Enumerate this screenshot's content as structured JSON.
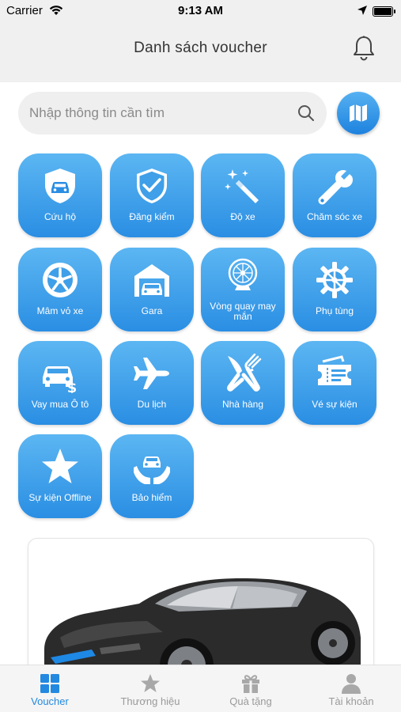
{
  "status_bar": {
    "carrier": "Carrier",
    "time": "9:13 AM"
  },
  "header": {
    "title": "Danh sách voucher"
  },
  "search": {
    "placeholder": "Nhập thông tin cần tìm",
    "value": ""
  },
  "categories": [
    {
      "label": "Cứu hộ",
      "icon": "shield-car-icon"
    },
    {
      "label": "Đăng kiểm",
      "icon": "shield-check-icon"
    },
    {
      "label": "Độ xe",
      "icon": "magic-wand-icon"
    },
    {
      "label": "Chăm sóc xe",
      "icon": "wrench-icon"
    },
    {
      "label": "Mâm vỏ xe",
      "icon": "wheel-icon"
    },
    {
      "label": "Gara",
      "icon": "garage-icon"
    },
    {
      "label": "Vòng quay may mắn",
      "icon": "lucky-wheel-icon"
    },
    {
      "label": "Phụ tùng",
      "icon": "gear-icon"
    },
    {
      "label": "Vay mua Ô tô",
      "icon": "car-loan-icon"
    },
    {
      "label": "Du lịch",
      "icon": "airplane-icon"
    },
    {
      "label": "Nhà hàng",
      "icon": "restaurant-icon"
    },
    {
      "label": "Vé sự kiện",
      "icon": "ticket-icon"
    },
    {
      "label": "Sự kiện Offline",
      "icon": "star-icon"
    },
    {
      "label": "Bảo hiểm",
      "icon": "insurance-icon"
    }
  ],
  "tabs": [
    {
      "label": "Voucher",
      "icon": "grid-icon",
      "active": true
    },
    {
      "label": "Thương hiệu",
      "icon": "star-icon",
      "active": false
    },
    {
      "label": "Quà tặng",
      "icon": "gift-icon",
      "active": false
    },
    {
      "label": "Tài khoản",
      "icon": "person-icon",
      "active": false
    }
  ],
  "colors": {
    "accent": "#2389e0",
    "tile_top": "#5cb6f2",
    "tile_bottom": "#2a8ee3",
    "header_bg": "#f0f0f0"
  }
}
